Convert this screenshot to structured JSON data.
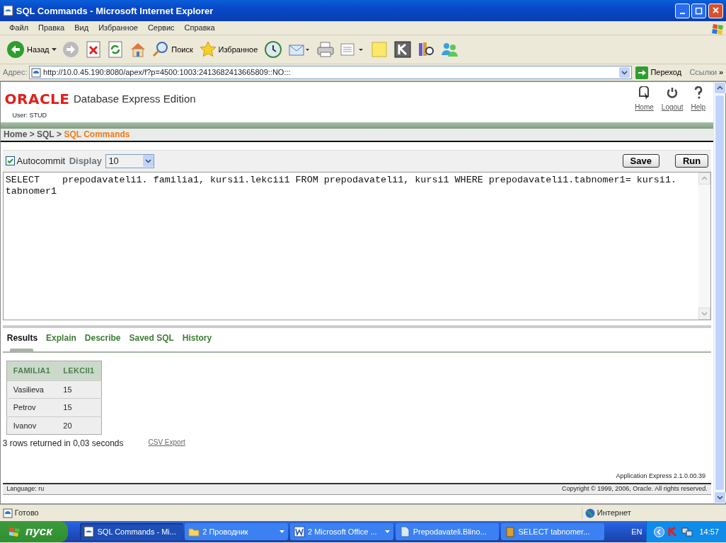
{
  "window": {
    "title": "SQL Commands - Microsoft Internet Explorer"
  },
  "menu": [
    "Файл",
    "Правка",
    "Вид",
    "Избранное",
    "Сервис",
    "Справка"
  ],
  "toolbar": [
    {
      "kind": "back",
      "label": "Назад"
    },
    {
      "kind": "forward"
    },
    {
      "kind": "stop"
    },
    {
      "kind": "refresh"
    },
    {
      "kind": "home"
    },
    {
      "kind": "search",
      "label": "Поиск"
    },
    {
      "kind": "favorites",
      "label": "Избранное"
    },
    {
      "kind": "history"
    },
    {
      "kind": "mail"
    },
    {
      "kind": "print"
    },
    {
      "kind": "edit"
    },
    {
      "kind": "note"
    },
    {
      "kind": "app"
    },
    {
      "kind": "research"
    },
    {
      "kind": "messenger"
    }
  ],
  "address": {
    "label": "Адрес:",
    "url": "http://10.0.45.190:8080/apex/f?p=4500:1003:2413682413665809::NO:::",
    "go": "Переход",
    "links": "Ссылки",
    "more": "»"
  },
  "page": {
    "logo": "ORACLE",
    "product": "Database Express Edition",
    "nav": [
      {
        "kind": "home",
        "label": "Home"
      },
      {
        "kind": "logout",
        "label": "Logout"
      },
      {
        "kind": "help",
        "label": "Help"
      }
    ],
    "user": "User: STUD",
    "breadcrumb": [
      {
        "kind": "link",
        "label": "Home"
      },
      {
        "kind": "separator",
        "label": " > "
      },
      {
        "kind": "link",
        "label": "SQL"
      },
      {
        "kind": "separator",
        "label": " > "
      },
      {
        "kind": "current",
        "label": "SQL Commands"
      }
    ],
    "autocommit": {
      "label": "Autocommit",
      "checked": true
    },
    "display": {
      "label": "Display",
      "value": "10"
    },
    "buttons": [
      "Save",
      "Run"
    ],
    "sql": "SELECT    prepodavateli1. familia1, kursi1.lekcii1 FROM prepodavateli1, kursi1 WHERE prepodavateli1.tabnomer1= kursi1. tabnomer1",
    "tabs": [
      {
        "label": "Results",
        "selected": true
      },
      {
        "label": "Explain",
        "selected": false
      },
      {
        "label": "Describe",
        "selected": false
      },
      {
        "label": "Saved SQL",
        "selected": false
      },
      {
        "label": "History",
        "selected": false
      }
    ],
    "table": {
      "columns": [
        "FAMILIA1",
        "LEKCII1"
      ],
      "rows": [
        [
          "Vasilieva",
          "15"
        ],
        [
          "Petrov",
          "15"
        ],
        [
          "Ivanov",
          "20"
        ]
      ]
    },
    "summary": "3 rows returned in 0,03 seconds",
    "export": "CSV Export",
    "version": "Application Express 2.1.0.00.39",
    "language": "Language: ru",
    "copyright": "Copyright © 1999, 2006, Oracle. All rights reserved."
  },
  "status_bar": {
    "text": "Готово",
    "zone": "Интернет"
  },
  "taskbar": {
    "start": "пуск",
    "tasks": [
      {
        "kind": "ie",
        "label": "SQL Commands - Mi...",
        "selected": true,
        "menu": false
      },
      {
        "kind": "folder",
        "label": "2 Проводник",
        "selected": false,
        "menu": true
      },
      {
        "kind": "word",
        "label": "2 Microsoft Office ...",
        "selected": false,
        "menu": true
      },
      {
        "kind": "doc",
        "label": "Prepodavateli.Blino...",
        "selected": false,
        "menu": false
      },
      {
        "kind": "app",
        "label": "SELECT   tabnomer...",
        "selected": false,
        "menu": false
      }
    ],
    "lang": "EN",
    "clock": "14:57"
  }
}
